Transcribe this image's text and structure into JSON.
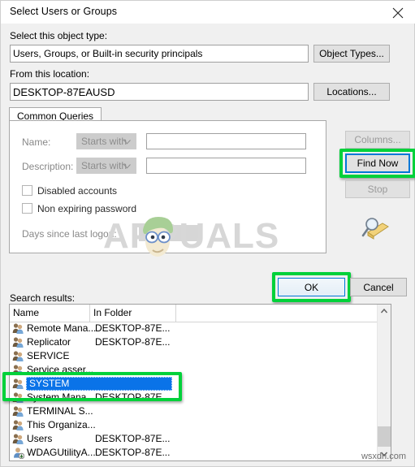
{
  "window": {
    "title": "Select Users or Groups",
    "close_icon": "close-icon"
  },
  "object_type": {
    "label": "Select this object type:",
    "value": "Users, Groups, or Built-in security principals",
    "button": "Object Types..."
  },
  "location": {
    "label": "From this location:",
    "value": "DESKTOP-87EAUSD",
    "button": "Locations..."
  },
  "tabs": [
    {
      "label": "Common Queries",
      "active": true
    }
  ],
  "query": {
    "name_label": "Name:",
    "name_operator": "Starts with",
    "name_value": "",
    "description_label": "Description:",
    "description_operator": "Starts with",
    "description_value": "",
    "disabled_accounts_label": "Disabled accounts",
    "disabled_accounts_checked": false,
    "non_expiring_password_label": "Non expiring password",
    "non_expiring_password_checked": false,
    "days_since_logon_label": "Days since last logon:",
    "days_since_logon_value": ""
  },
  "side_buttons": {
    "columns": "Columns...",
    "columns_enabled": false,
    "find_now": "Find Now",
    "find_now_focused": true,
    "stop": "Stop",
    "stop_enabled": false,
    "search_icon": "magnifier-folder-icon"
  },
  "dialog_buttons": {
    "ok": "OK",
    "cancel": "Cancel"
  },
  "results": {
    "label": "Search results:",
    "columns": [
      "Name",
      "In Folder"
    ],
    "rows": [
      {
        "name": "Remote Mana...",
        "folder": "DESKTOP-87E...",
        "icon": "group-icon",
        "selected": false
      },
      {
        "name": "Replicator",
        "folder": "DESKTOP-87E...",
        "icon": "group-icon",
        "selected": false
      },
      {
        "name": "SERVICE",
        "folder": "",
        "icon": "group-icon",
        "selected": false
      },
      {
        "name": "Service asser...",
        "folder": "",
        "icon": "group-icon",
        "selected": false
      },
      {
        "name": "SYSTEM",
        "folder": "",
        "icon": "group-icon",
        "selected": true
      },
      {
        "name": "System Mana...",
        "folder": "DESKTOP-87E...",
        "icon": "group-icon",
        "selected": false
      },
      {
        "name": "TERMINAL S...",
        "folder": "",
        "icon": "group-icon",
        "selected": false
      },
      {
        "name": "This Organiza...",
        "folder": "",
        "icon": "group-icon",
        "selected": false
      },
      {
        "name": "Users",
        "folder": "DESKTOP-87E...",
        "icon": "group-icon",
        "selected": false
      },
      {
        "name": "WDAGUtilityA...",
        "folder": "DESKTOP-87E...",
        "icon": "user-icon",
        "selected": false
      }
    ]
  },
  "watermark": {
    "text": "APPUALS",
    "corner_text": "wsxdn.com"
  },
  "annotations": {
    "highlight_color": "#00d13a",
    "targets": [
      "find-now-button",
      "ok-button",
      "system-result-row"
    ]
  }
}
